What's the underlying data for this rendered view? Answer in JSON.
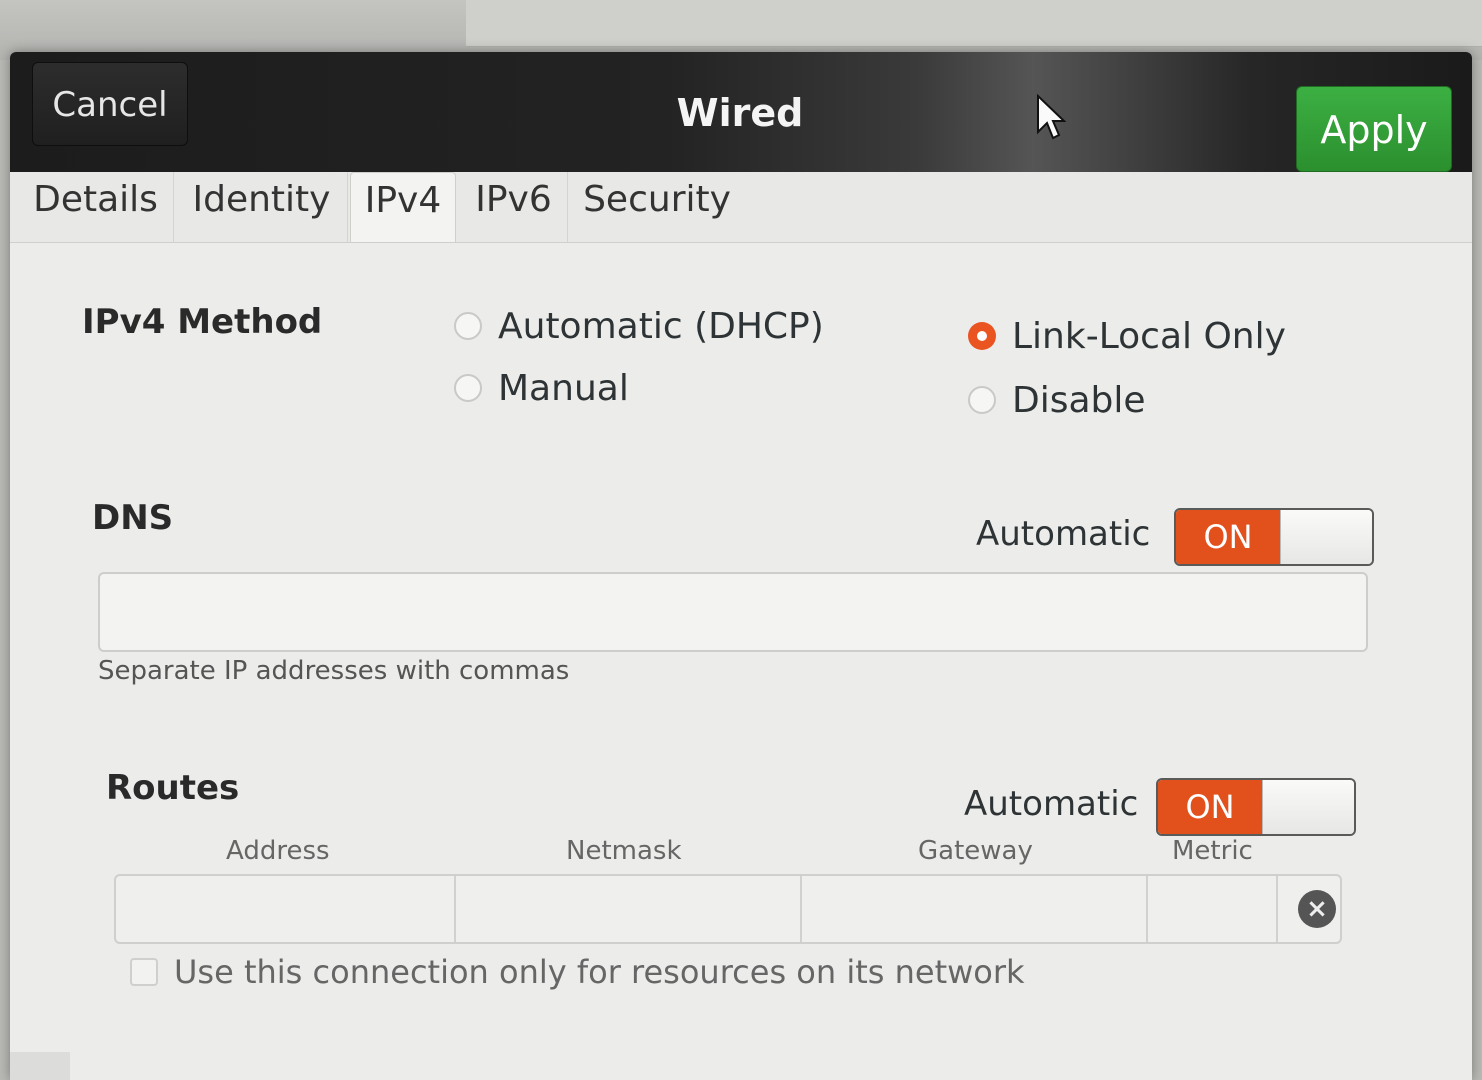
{
  "header": {
    "cancel_label": "Cancel",
    "title": "Wired",
    "apply_label": "Apply"
  },
  "tabs": [
    {
      "label": "Details",
      "active": false
    },
    {
      "label": "Identity",
      "active": false
    },
    {
      "label": "IPv4",
      "active": true
    },
    {
      "label": "IPv6",
      "active": false
    },
    {
      "label": "Security",
      "active": false
    }
  ],
  "ipv4_method": {
    "label": "IPv4 Method",
    "options": [
      {
        "label": "Automatic (DHCP)",
        "checked": false
      },
      {
        "label": "Manual",
        "checked": false
      },
      {
        "label": "Link-Local Only",
        "checked": true
      },
      {
        "label": "Disable",
        "checked": false
      }
    ]
  },
  "dns": {
    "label": "DNS",
    "automatic_label": "Automatic",
    "switch_label": "ON",
    "switch_on": true,
    "entry_value": "",
    "hint": "Separate IP addresses with commas"
  },
  "routes": {
    "label": "Routes",
    "automatic_label": "Automatic",
    "switch_label": "ON",
    "switch_on": true,
    "columns": [
      "Address",
      "Netmask",
      "Gateway",
      "Metric"
    ],
    "row": {
      "address": "",
      "netmask": "",
      "gateway": "",
      "metric": ""
    },
    "only_local_label": "Use this connection only for resources on its network",
    "only_local_checked": false
  },
  "colors": {
    "accent": "#e95420",
    "apply_green": "#3cb043",
    "headerbar": "#1f1f1f"
  }
}
